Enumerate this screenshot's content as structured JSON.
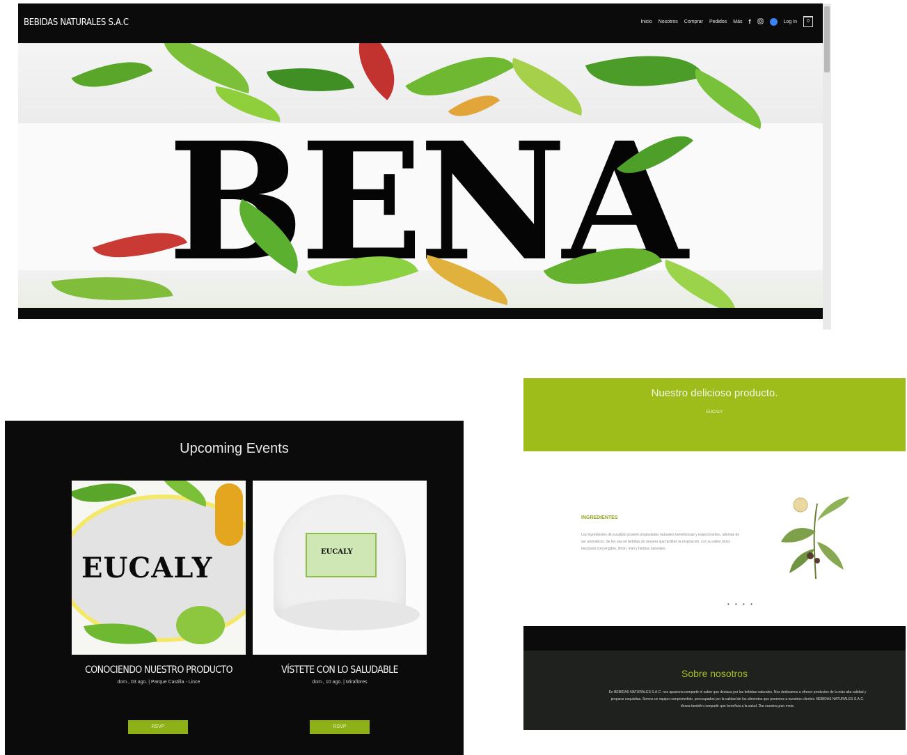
{
  "site": {
    "brand": "BEBIDAS NATURALES S.A.C",
    "nav": [
      "Inicio",
      "Nosotros",
      "Comprar",
      "Pedidos",
      "Más"
    ],
    "login_label": "Log In",
    "cart_count": "0",
    "hero_word": "BENA"
  },
  "events": {
    "title": "Upcoming Events",
    "items": [
      {
        "name": "CONOCIENDO NUESTRO PRODUCTO",
        "meta": "dom., 03 ago. | Parque Castilla - Lince",
        "button": "RSVP",
        "image_text": "EUCALY"
      },
      {
        "name": "VÍSTETE CON LO SALUDABLE",
        "meta": "dom., 10 ago. | Miraflores",
        "button": "RSVP",
        "image_text": "EUCALY"
      }
    ]
  },
  "product": {
    "title": "Nuestro delicioso producto.",
    "subtitle": "EUCALY",
    "ingredients_title": "INGREDIENTES",
    "ingredients_text": "Los ingredientes de eucalipto poseen propiedades naturales beneficiosas y expectorantes, además de ser aromáticos. Se los usa en bebidas de manera que faciliten la respiración, con su sabor único mezclado con jengibre, limón, miel y hierbas naturales.",
    "carousel_dots": "• • • •"
  },
  "about": {
    "title": "Sobre nosotros",
    "text": "En BEBIDAS NATURALES S.A.C. nos apasiona compartir el sabor que destaca por las bebidas naturales. Nos dedicamos a ofrecer productos de la más alta calidad y preparar exquisitas. Somos un equipo comprometido, preocupados por la calidad de los alimentos que ponemos a nuestros clientes. BEBIDAS NATURALES S.A.C. desea también compartir que beneficia a la salud. Dar nuestra gran meta."
  },
  "colors": {
    "accent_green": "#9ebd1a",
    "button_green": "#8fb118",
    "dark": "#0b0b0b"
  }
}
